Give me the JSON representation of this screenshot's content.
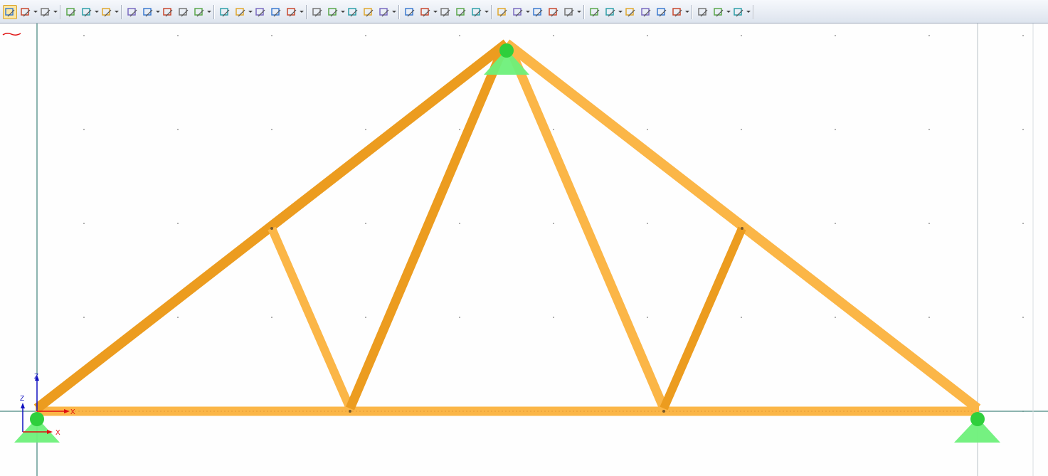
{
  "toolbar": {
    "buttons": [
      "display-navigator-icon",
      "select-nodes-icon",
      "render-mode-icon",
      "new-node-icon",
      "new-line-icon",
      "grid-snap-icon",
      "members-icon",
      "supports-icon",
      "hinges-icon",
      "view-3d-icon",
      "sections-icon",
      "move-copy-icon",
      "connect-icon",
      "divide-member-icon",
      "split-icon",
      "mesh-icon",
      "zoom-all-icon",
      "zoom-window-icon",
      "zoom-previous-icon",
      "view-box-icon",
      "view-isometric-icon",
      "view-x-icon",
      "view-y-icon",
      "view-z-icon",
      "view-minus-x-icon",
      "rotate-view-icon",
      "display-options-icon",
      "perspective-icon",
      "filter-icon",
      "member-axes-icon",
      "surface-icon",
      "solid-icon",
      "arrow-icon",
      "beam-icon",
      "grid-icon",
      "ruler-icon",
      "table-icon",
      "report-icon",
      "color-scale-icon",
      "results-icon"
    ],
    "active_button": "display-navigator-icon"
  },
  "viewport": {
    "global_axes": {
      "z_label": "Z",
      "x_label": "X"
    },
    "local_axes": {
      "z_label": "Z",
      "x_label": "X"
    }
  },
  "colors": {
    "member_dark": "#ec9c1f",
    "member_light": "#fbb647",
    "support": "#6ef07a",
    "support_pin": "#2fcf3c",
    "grid_line": "#1a6b60",
    "axis_x": "#e01010",
    "axis_z": "#1010c0"
  }
}
